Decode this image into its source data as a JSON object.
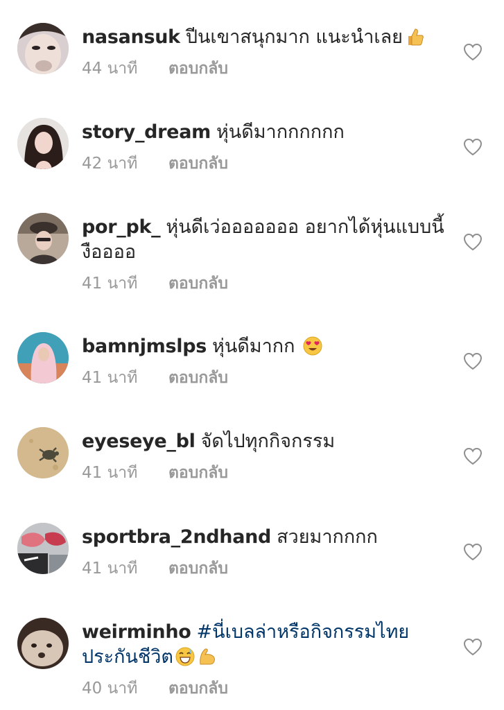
{
  "comments": [
    {
      "username": "nasansuk",
      "text": "ปีนเขาสนุกมาก แนะนำเลย",
      "emoji": "thumbs-up-emoji",
      "time": "44 นาที",
      "reply": "ตอบกลับ"
    },
    {
      "username": "story_dream",
      "text": "หุ่นดีมากกกกกก",
      "time": "42 นาที",
      "reply": "ตอบกลับ"
    },
    {
      "username": "por_pk_",
      "text": "หุ่นดีเว่อออออออ อยากได้หุ่นแบบนี้ งืออออ",
      "time": "41 นาที",
      "reply": "ตอบกลับ"
    },
    {
      "username": "bamnjmslps",
      "text": "หุ่นดีมากก",
      "emoji": "heart-eyes-emoji",
      "time": "41 นาที",
      "reply": "ตอบกลับ"
    },
    {
      "username": "eyeseye_bl",
      "text": "จัดไปทุกกิจกรรม",
      "time": "41 นาที",
      "reply": "ตอบกลับ"
    },
    {
      "username": "sportbra_2ndhand",
      "text": "สวยมากกกก",
      "time": "41 นาที",
      "reply": "ตอบกลับ"
    },
    {
      "username": "weirminho",
      "hashtag": "#นี่เบลล่าหรือกิจกรรมไทยประกันชีวิต",
      "emoji": "grinning-sweat-emoji",
      "emoji2": "flexed-biceps-emoji",
      "time": "40 นาที",
      "reply": "ตอบกลับ"
    }
  ],
  "icons": {
    "like": "heart-outline-icon"
  },
  "colors": {
    "text": "#262626",
    "meta": "#999999",
    "hashtag": "#003569"
  }
}
